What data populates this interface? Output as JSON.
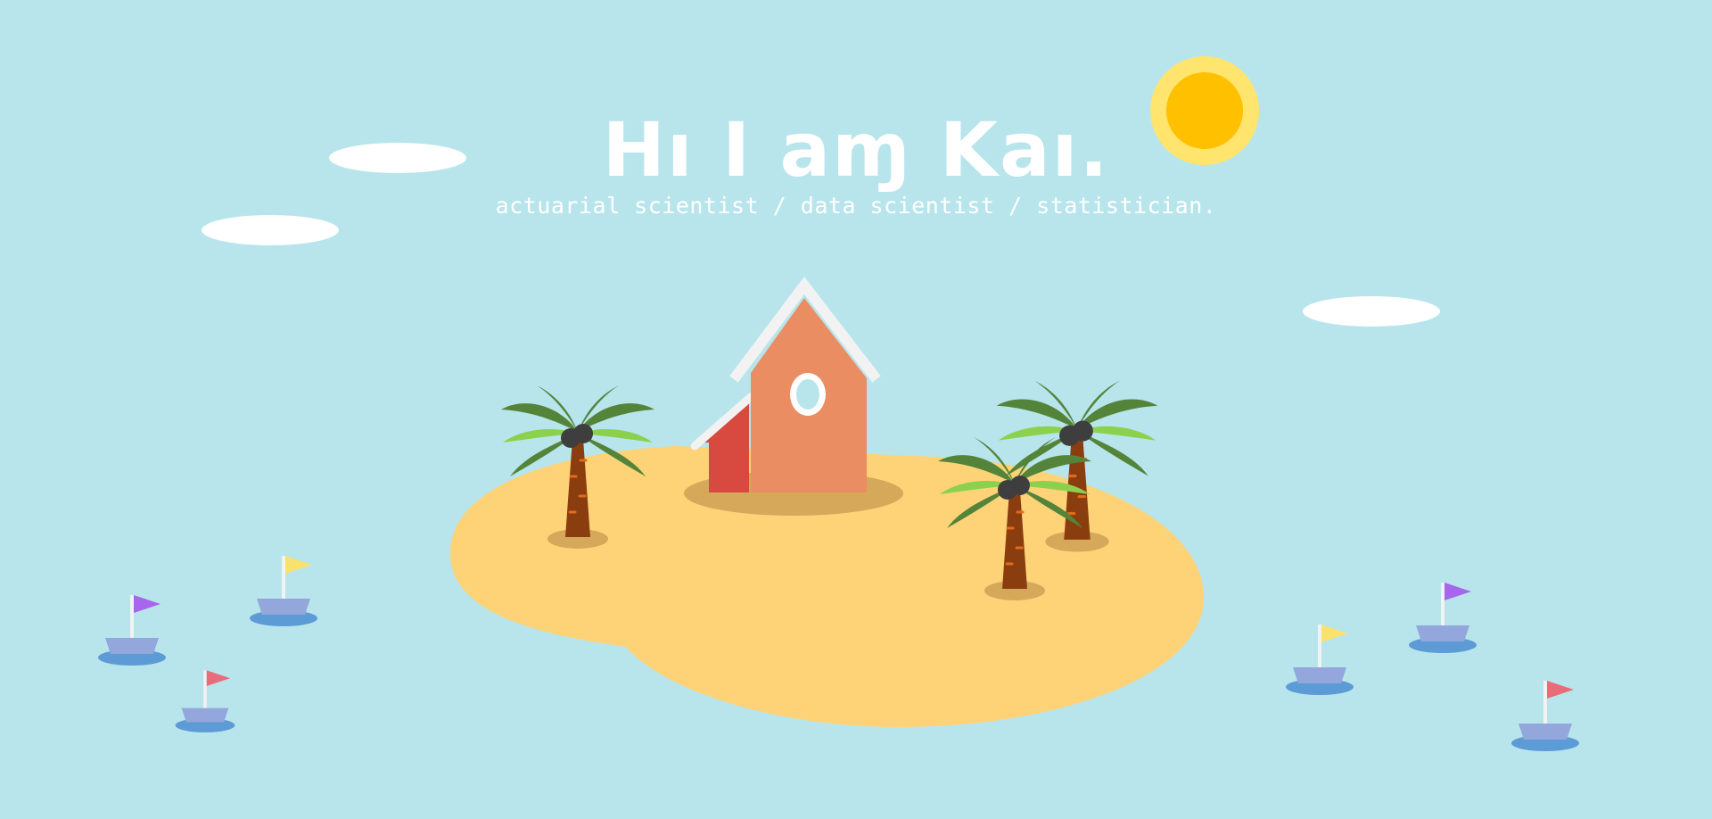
{
  "hero": {
    "title": "Hı I aɱ Kaı.",
    "subtitle": "actuarial scientist / data scientist / statistician."
  },
  "scene": {
    "sky_color": "#b8e5ec",
    "sun_color": "#ffc000",
    "sun_glow_color": "#ffe46e",
    "sand_color": "#fed377",
    "house_wall_color": "#ea8d63",
    "house_side_color": "#d84940",
    "palm_leaf_dark": "#54843a",
    "palm_leaf_light": "#8cd14e",
    "palm_trunk_color": "#8a3d0e",
    "boat_hull_color": "#93a7dc",
    "water_ring_color": "#5d9bd6",
    "flag_colors": [
      "#a865ee",
      "#f8e16f",
      "#e96c7a"
    ],
    "icons": [
      "sun-icon",
      "cloud-icon",
      "house-icon",
      "palm-tree-icon",
      "sailboat-icon",
      "flag-icon"
    ]
  }
}
